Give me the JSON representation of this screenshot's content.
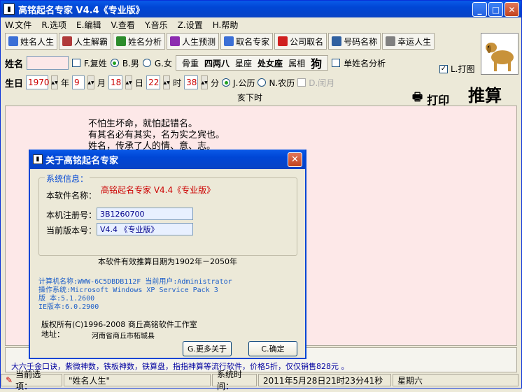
{
  "app": {
    "title": "高铭起名专家   V4.4《专业版》"
  },
  "menu": [
    {
      "label": "W.文件"
    },
    {
      "label": "R.选项"
    },
    {
      "label": "E.编辑"
    },
    {
      "label": "V.查看"
    },
    {
      "label": "Y.音乐"
    },
    {
      "label": "Z.设置"
    },
    {
      "label": "H.帮助"
    }
  ],
  "toolbar": [
    {
      "label": "姓名人生",
      "icon": "chart-icon",
      "color": "#3b6fd6"
    },
    {
      "label": "人生解霸",
      "icon": "book-icon",
      "color": "#b03a3a"
    },
    {
      "label": "姓名分析",
      "icon": "book-icon",
      "color": "#2c8c2c"
    },
    {
      "label": "人生预测",
      "icon": "book-icon",
      "color": "#8c2cb0"
    },
    {
      "label": "取名专家",
      "icon": "book-icon",
      "color": "#3b6fd6"
    },
    {
      "label": "公司取名",
      "icon": "gem-icon",
      "color": "#d02020"
    },
    {
      "label": "号码名称",
      "icon": "eye-icon",
      "color": "#3060a0"
    },
    {
      "label": "幸运人生",
      "icon": "stamp-icon",
      "color": "#808080"
    }
  ],
  "form": {
    "name_label": "姓名",
    "name_value": "",
    "compound_surname": "F.复姓",
    "male": "B.男",
    "female": "G.女",
    "info": {
      "bone": "骨重",
      "bone_val": "四两八",
      "star": "星座",
      "star_val": "处女座",
      "zodiac": "属相",
      "zodiac_val": "狗"
    },
    "single_name": "单姓名分析",
    "print_pic": "L.打图",
    "birth_label": "生日",
    "year": "1970",
    "year_unit": "年",
    "month": "9",
    "month_unit": "月",
    "day": "18",
    "day_unit": "日",
    "hour": "22",
    "hour_unit": "时",
    "minute": "38",
    "minute_unit": "分",
    "solar": "J.公历",
    "lunar": "N.农历",
    "leap": "D.闰月",
    "time_label": "亥下时",
    "print": "打印",
    "calc": "推算"
  },
  "main": {
    "line1": "不怕生坏命，就怕起错名。",
    "line2": "有其名必有其实，名为实之宾也。",
    "line3": "姓名，传承了人的情、意、志。"
  },
  "promo": "大六壬金口诀，紫微神数，铁板神数，铁算盘，指指神算等流行软件，价格5折，仅仅销售828元 。",
  "status": {
    "current_label": "当前选项：",
    "current_value": "\"姓名人生\"",
    "time_label": "系统时间：",
    "time_value": "2011年5月28日21时23分41秒",
    "weekday": "星期六"
  },
  "dialog": {
    "title": "关于高铭起名专家",
    "group": "系统信息：",
    "sw_label": "本软件名称：",
    "sw_value": "高铭起名专家   V4.4《专业版》",
    "reg_label": "本机注册号：",
    "reg_value": "3B1260700",
    "ver_label": "当前版本号：",
    "ver_value": "V4.4 《专业版》",
    "valid": "本软件有效推算日期为1902年－2050年",
    "sys1": "计算机名称:WWW-6C5DBDB112F   当前用户:Administrator",
    "sys2": "操作系统:Microsoft Windows XP Service Pack 3",
    "sys3": "版  本:5.1.2600",
    "sys4": "IE版本:6.0.2900",
    "copyright": "版权所有(C)1996-2008      商丘高铭软件工作室",
    "addr_label": "地址：",
    "addr_value": "河南省商丘市柘城县",
    "more_btn": "G.更多关于",
    "ok_btn": "C.确定"
  }
}
